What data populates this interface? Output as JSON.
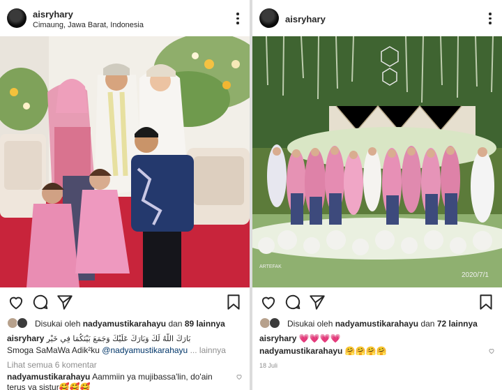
{
  "left_post": {
    "username": "aisryhary",
    "location": "Cimaung, Jawa Barat, Indonesia",
    "likes": {
      "prefix": "Disukai oleh",
      "user": "nadyamustikarahayu",
      "connector": "dan",
      "count": "89 lainnya"
    },
    "caption": {
      "username": "aisryhary",
      "arabic": "بَارَكَ اللَّهُ لَكَ وَبَارَكَ عَلَيْكَ وَجَمَعَ بَيْنَكُمَا فِي خَيْرٍ",
      "second_line_text": "Smoga SaMaWa Adik²ku",
      "mention": "@nadyamustikarahayu",
      "more": "... lainnya"
    },
    "view_comments": "Lihat semua 6 komentar",
    "comment": {
      "username": "nadyamustikarahayu",
      "text": "Aammiin ya mujibassa'lin, do'ain",
      "cut_text": "terus ya sistur🥰🥰🥰"
    }
  },
  "right_post": {
    "username": "aisryhary",
    "photo_watermark": "2020/7/1",
    "photo_stamp": "ARTEFAK",
    "likes": {
      "prefix": "Disukai oleh",
      "user": "nadyamustikarahayu",
      "connector": "dan",
      "count": "72 lainnya"
    },
    "caption": {
      "username": "aisryhary",
      "emojis": "💗💗💗💗"
    },
    "comment": {
      "username": "nadyamustikarahayu",
      "text": "🤗🤗🤗🤗"
    },
    "date": "18 Juli"
  },
  "icons": [
    "more-icon",
    "heart-icon",
    "comment-icon",
    "share-icon",
    "bookmark-icon"
  ],
  "colors": {
    "text": "#262626",
    "muted": "#8e8e8e",
    "mention": "#003569",
    "divider": "#dcdcdc"
  }
}
